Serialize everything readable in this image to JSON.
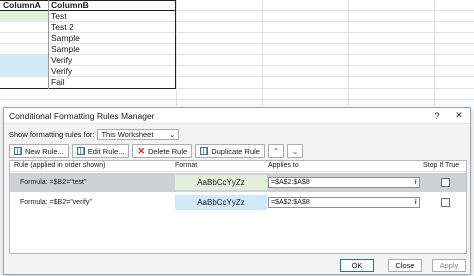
{
  "sheet": {
    "headers": [
      "ColumnA",
      "ColumnB"
    ],
    "rows": [
      "Test",
      "Test 2",
      "Sample",
      "Sample",
      "Verify",
      "Verify",
      "Fail"
    ]
  },
  "dialog": {
    "title": "Conditional Formatting Rules Manager",
    "show_label": "Show formatting rules for:",
    "show_value": "This Worksheet",
    "toolbar": {
      "new_rule": "New Rule...",
      "edit_rule": "Edit Rule...",
      "delete_rule": "Delete Rule",
      "duplicate_rule": "Duplicate Rule"
    },
    "columns": {
      "rule": "Rule (applied in order shown)",
      "format": "Format",
      "applies_to": "Applies to",
      "stop_if_true": "Stop If True"
    },
    "rules": [
      {
        "name": "Formula: =$B2=\"test\"",
        "preview": "AaBbCcYyZz",
        "applies_to": "=$A$2:$A$8",
        "color": "#e2efda",
        "selected": true
      },
      {
        "name": "Formula: =$B2=\"verify\"",
        "preview": "AaBbCcYyZz",
        "applies_to": "=$A$2:$A$8",
        "color": "#cfe9f7",
        "selected": false
      }
    ],
    "buttons": {
      "ok": "OK",
      "close": "Close",
      "apply": "Apply"
    }
  }
}
